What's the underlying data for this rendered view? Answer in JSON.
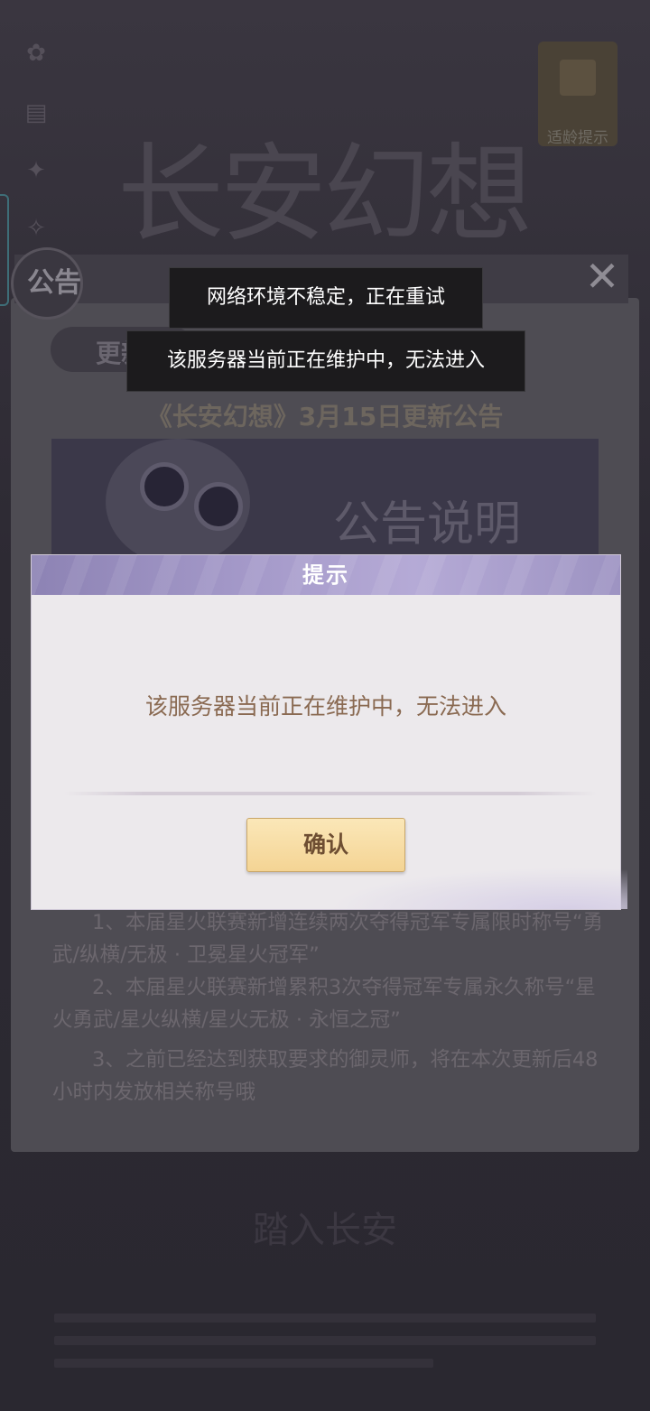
{
  "background": {
    "logo_text": "长安幻想",
    "age_rating_label": "适龄提示",
    "enter_game_label": "踏入长安"
  },
  "notice": {
    "title": "公告",
    "tab_label": "更新公告",
    "headline": "《长安幻想》3月15日更新公告",
    "banner_text": "公告说明",
    "paragraphs": [
      "1、本届星火联赛新增连续两次夺得冠军专属限时称号“勇武/纵横/无极 · 卫冕星火冠军”",
      "2、本届星火联赛新增累积3次夺得冠军专属永久称号“星火勇武/星火纵横/星火无极 · 永恒之冠”",
      "3、之前已经达到获取要求的御灵师，将在本次更新后48小时内发放相关称号哦"
    ]
  },
  "toasts": [
    "网络环境不稳定，正在重试",
    "该服务器当前正在维护中，无法进入"
  ],
  "dialog": {
    "title": "提示",
    "message": "该服务器当前正在维护中，无法进入",
    "confirm_label": "确认"
  },
  "colors": {
    "dialog_header": "#a398c8",
    "confirm_button": "#f4d494",
    "message_text": "#8a6a52"
  }
}
